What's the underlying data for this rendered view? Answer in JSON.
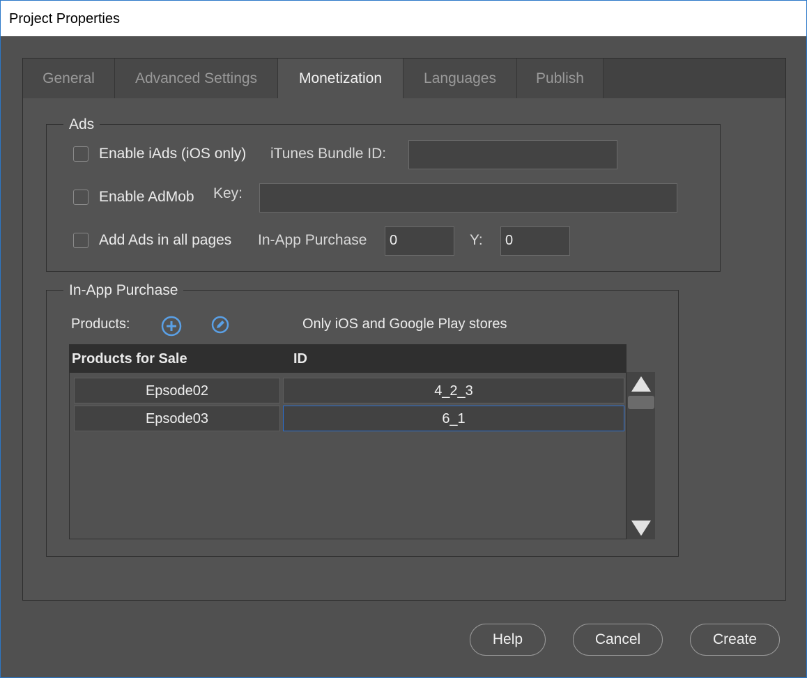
{
  "window": {
    "title": "Project Properties"
  },
  "tabs": [
    "General",
    "Advanced Settings",
    "Monetization",
    "Languages",
    "Publish"
  ],
  "ads": {
    "legend": "Ads",
    "enable_iads_label": "Enable iAds (iOS only)",
    "enable_iads_checked": false,
    "itunes_bundle_label": "iTunes Bundle ID:",
    "itunes_bundle_value": "",
    "enable_admob_label": "Enable AdMob",
    "enable_admob_checked": false,
    "key_label": "Key:",
    "key_value": "",
    "add_ads_label": "Add Ads in all pages",
    "add_ads_checked": false,
    "inapp_label": "In-App Purchase",
    "inapp_value": "0",
    "y_label": "Y:",
    "y_value": "0"
  },
  "iap": {
    "legend": "In-App Purchase",
    "products_label": "Products:",
    "note": "Only iOS and Google Play stores",
    "columns": [
      "Products for Sale",
      "ID"
    ],
    "rows": [
      {
        "name": "Epsode02",
        "id": "4_2_3"
      },
      {
        "name": "Epsode03",
        "id": "6_1"
      }
    ]
  },
  "footer": {
    "help": "Help",
    "cancel": "Cancel",
    "create": "Create"
  },
  "colors": {
    "accent": "#2b78c8",
    "selection": "#2b6fd1",
    "icon": "#5aa0e6"
  }
}
